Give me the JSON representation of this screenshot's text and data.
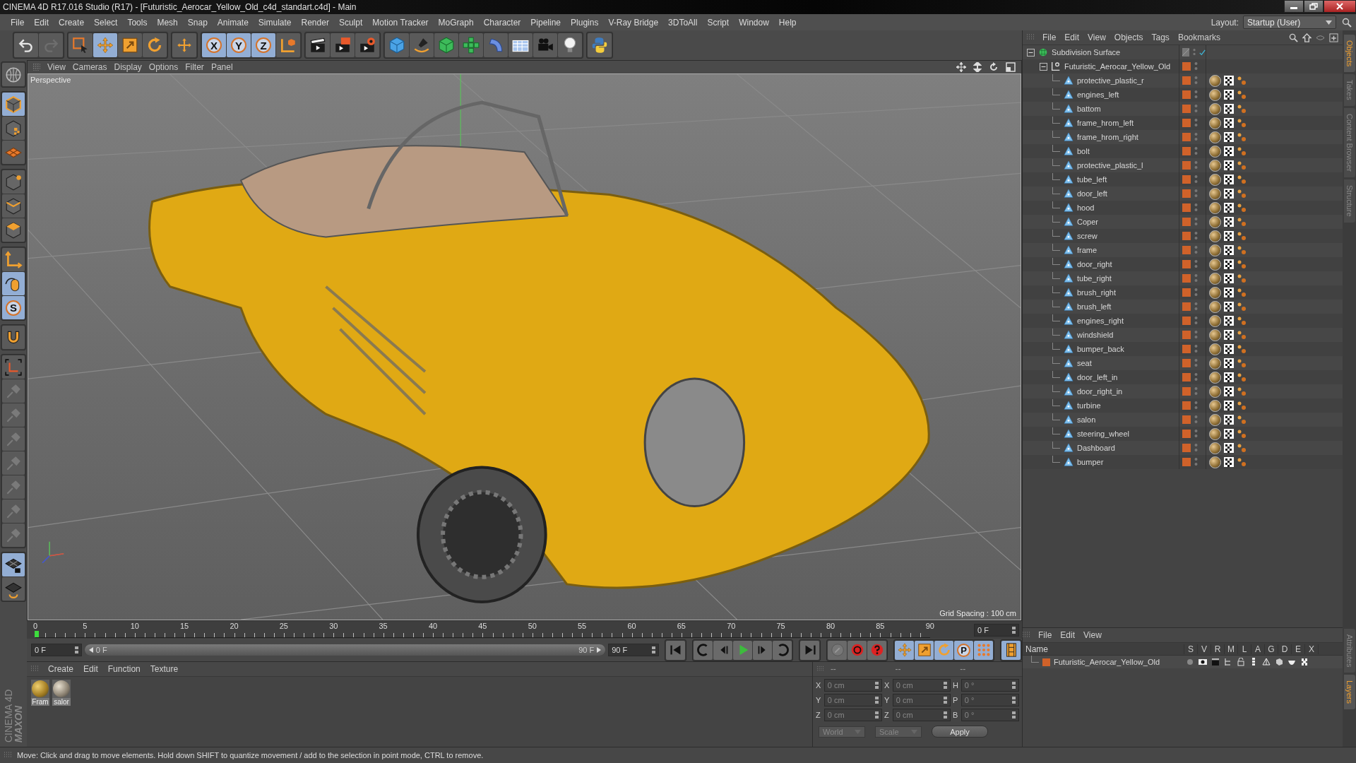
{
  "window": {
    "title": "CINEMA 4D R17.016 Studio (R17) - [Futuristic_Aerocar_Yellow_Old_c4d_standart.c4d] - Main"
  },
  "menu": [
    "File",
    "Edit",
    "Create",
    "Select",
    "Tools",
    "Mesh",
    "Snap",
    "Animate",
    "Simulate",
    "Render",
    "Sculpt",
    "Motion Tracker",
    "MoGraph",
    "Character",
    "Pipeline",
    "Plugins",
    "V-Ray Bridge",
    "3DToAll",
    "Script",
    "Window",
    "Help"
  ],
  "layout": {
    "label": "Layout:",
    "value": "Startup (User)"
  },
  "toolbar": [
    [
      {
        "kind": "undo",
        "active": false
      },
      {
        "kind": "redo",
        "active": false
      }
    ],
    [
      {
        "kind": "select",
        "active": false
      },
      {
        "kind": "move",
        "active": true
      },
      {
        "kind": "scale",
        "active": false
      },
      {
        "kind": "rotate",
        "active": false
      }
    ],
    [
      {
        "kind": "transform",
        "active": false
      }
    ],
    [
      {
        "kind": "letter",
        "label": "X",
        "active": true
      },
      {
        "kind": "letter",
        "label": "Y",
        "active": true
      },
      {
        "kind": "letter",
        "label": "Z",
        "active": true
      },
      {
        "kind": "coord",
        "active": false
      }
    ],
    [
      {
        "kind": "render",
        "active": false
      },
      {
        "kind": "render-view",
        "active": false
      },
      {
        "kind": "render-settings",
        "active": false
      }
    ],
    [
      {
        "kind": "cube",
        "active": false
      },
      {
        "kind": "pen",
        "active": false
      },
      {
        "kind": "subdiv",
        "active": false
      },
      {
        "kind": "cloner",
        "active": false
      },
      {
        "kind": "deformer",
        "active": false
      },
      {
        "kind": "floor",
        "active": false
      },
      {
        "kind": "camera",
        "active": false
      },
      {
        "kind": "light",
        "active": false
      }
    ],
    [
      {
        "kind": "python",
        "active": false
      }
    ]
  ],
  "left_toolbar": [
    [
      {
        "kind": "globe",
        "active": false
      }
    ],
    [
      {
        "kind": "model",
        "active": true
      },
      {
        "kind": "texture",
        "active": false
      },
      {
        "kind": "workplane",
        "active": false
      }
    ],
    [
      {
        "kind": "point",
        "active": false
      },
      {
        "kind": "edge",
        "active": false
      },
      {
        "kind": "polygon",
        "active": false
      }
    ],
    [
      {
        "kind": "axis",
        "active": false
      },
      {
        "kind": "tweak",
        "active": true
      },
      {
        "kind": "letter",
        "label": "S",
        "active": true
      }
    ],
    [
      {
        "kind": "magnet",
        "active": false
      }
    ],
    [
      {
        "kind": "quantize",
        "active": false
      },
      {
        "kind": "pin",
        "active": false
      },
      {
        "kind": "pin",
        "active": false
      },
      {
        "kind": "pin",
        "active": false
      },
      {
        "kind": "pin",
        "active": false
      },
      {
        "kind": "pin",
        "active": false
      },
      {
        "kind": "pin",
        "active": false
      },
      {
        "kind": "pin",
        "active": false
      }
    ],
    [
      {
        "kind": "lock-grid",
        "active": true
      },
      {
        "kind": "grid-refresh",
        "active": false
      }
    ]
  ],
  "logo": [
    "MAXON",
    "CINEMA 4D"
  ],
  "viewport": {
    "menu": [
      "View",
      "Cameras",
      "Display",
      "Options",
      "Filter",
      "Panel"
    ],
    "camera": "Perspective",
    "grid_spacing": "Grid Spacing : 100 cm"
  },
  "timeline": {
    "ticks": [
      "0",
      "5",
      "10",
      "15",
      "20",
      "25",
      "30",
      "35",
      "40",
      "45",
      "50",
      "55",
      "60",
      "65",
      "70",
      "75",
      "80",
      "85",
      "90"
    ],
    "playhead": {
      "level": 0
    },
    "current_frame": "0 F",
    "start_field": "0 F",
    "range": {
      "level": 1
    },
    "range_start": "0 F",
    "range_end": "90 F",
    "end_field": "90 F",
    "controls": [
      [
        {
          "kind": "first",
          "active": false
        }
      ],
      [
        {
          "kind": "prev-key",
          "active": false
        },
        {
          "kind": "prev",
          "active": false
        },
        {
          "kind": "play",
          "active": false
        },
        {
          "kind": "next",
          "active": false
        },
        {
          "kind": "next-key",
          "active": false
        }
      ],
      [
        {
          "kind": "last",
          "active": false
        }
      ],
      [
        {
          "kind": "keyframe",
          "active": false
        },
        {
          "kind": "record",
          "active": false
        },
        {
          "kind": "autokey",
          "active": false
        }
      ],
      [
        {
          "kind": "move",
          "active": true
        },
        {
          "kind": "scale",
          "active": true
        },
        {
          "kind": "rotate",
          "active": true
        },
        {
          "kind": "letter",
          "label": "P",
          "active": true
        },
        {
          "kind": "dots",
          "active": true
        }
      ],
      [
        {
          "kind": "film",
          "active": true
        }
      ]
    ]
  },
  "materials": {
    "menu": [
      "Create",
      "Edit",
      "Function",
      "Texture"
    ],
    "items": [
      {
        "label": "Fram"
      },
      {
        "label": "salor"
      }
    ]
  },
  "coordinates": {
    "headers": [
      "--",
      "--",
      "--"
    ],
    "rows": [
      {
        "a": "X",
        "a_value": "0 cm",
        "b": "X",
        "b_value": "0 cm",
        "c": "H",
        "c_value": "0 °"
      },
      {
        "a": "Y",
        "a_value": "0 cm",
        "b": "Y",
        "b_value": "0 cm",
        "c": "P",
        "c_value": "0 °"
      },
      {
        "a": "Z",
        "a_value": "0 cm",
        "b": "Z",
        "b_value": "0 cm",
        "c": "B",
        "c_value": "0 °"
      }
    ],
    "mode": "World",
    "transform": "Scale",
    "apply": "Apply"
  },
  "objects": {
    "menu": [
      "File",
      "Edit",
      "View",
      "Objects",
      "Tags",
      "Bookmarks"
    ],
    "tree": [
      {
        "name": "Subdivision Surface",
        "kind": "subdivision",
        "expanded": true,
        "children": [
          {
            "name": "Futuristic_Aerocar_Yellow_Old",
            "kind": "null",
            "expanded": true,
            "children": [
              {
                "name": "protective_plastic_r",
                "kind": "polygon"
              },
              {
                "name": "engines_left",
                "kind": "polygon"
              },
              {
                "name": "battom",
                "kind": "polygon"
              },
              {
                "name": "frame_hrom_left",
                "kind": "polygon"
              },
              {
                "name": "frame_hrom_right",
                "kind": "polygon"
              },
              {
                "name": "bolt",
                "kind": "polygon"
              },
              {
                "name": "protective_plastic_l",
                "kind": "polygon"
              },
              {
                "name": "tube_left",
                "kind": "polygon"
              },
              {
                "name": "door_left",
                "kind": "polygon"
              },
              {
                "name": "hood",
                "kind": "polygon"
              },
              {
                "name": "Coper",
                "kind": "polygon"
              },
              {
                "name": "screw",
                "kind": "polygon"
              },
              {
                "name": "frame",
                "kind": "polygon"
              },
              {
                "name": "door_right",
                "kind": "polygon"
              },
              {
                "name": "tube_right",
                "kind": "polygon"
              },
              {
                "name": "brush_right",
                "kind": "polygon"
              },
              {
                "name": "brush_left",
                "kind": "polygon"
              },
              {
                "name": "engines_right",
                "kind": "polygon"
              },
              {
                "name": "windshield",
                "kind": "polygon"
              },
              {
                "name": "bumper_back",
                "kind": "polygon"
              },
              {
                "name": "seat",
                "kind": "polygon"
              },
              {
                "name": "door_left_in",
                "kind": "polygon"
              },
              {
                "name": "door_right_in",
                "kind": "polygon"
              },
              {
                "name": "turbine",
                "kind": "polygon"
              },
              {
                "name": "salon",
                "kind": "polygon"
              },
              {
                "name": "steering_wheel",
                "kind": "polygon"
              },
              {
                "name": "Dashboard",
                "kind": "polygon"
              },
              {
                "name": "bumper",
                "kind": "polygon"
              }
            ]
          }
        ]
      }
    ]
  },
  "layers": {
    "menu": [
      "File",
      "Edit",
      "View"
    ],
    "columns": [
      "Name",
      "S",
      "V",
      "R",
      "M",
      "L",
      "A",
      "G",
      "D",
      "E",
      "X"
    ],
    "rows": [
      {
        "name": "Futuristic_Aerocar_Yellow_Old",
        "color": "#d0622a"
      }
    ]
  },
  "side_tabs_top": [
    {
      "label": "Objects",
      "selected": true
    },
    {
      "label": "Takes",
      "selected": false
    },
    {
      "label": "Content Browser",
      "selected": false
    },
    {
      "label": "Structure",
      "selected": false
    }
  ],
  "side_tabs_bottom": [
    {
      "label": "Attributes",
      "selected": false
    },
    {
      "label": "Layers",
      "selected": true
    }
  ],
  "status": "Move: Click and drag to move elements. Hold down SHIFT to quantize movement / add to the selection in point mode, CTRL to remove."
}
